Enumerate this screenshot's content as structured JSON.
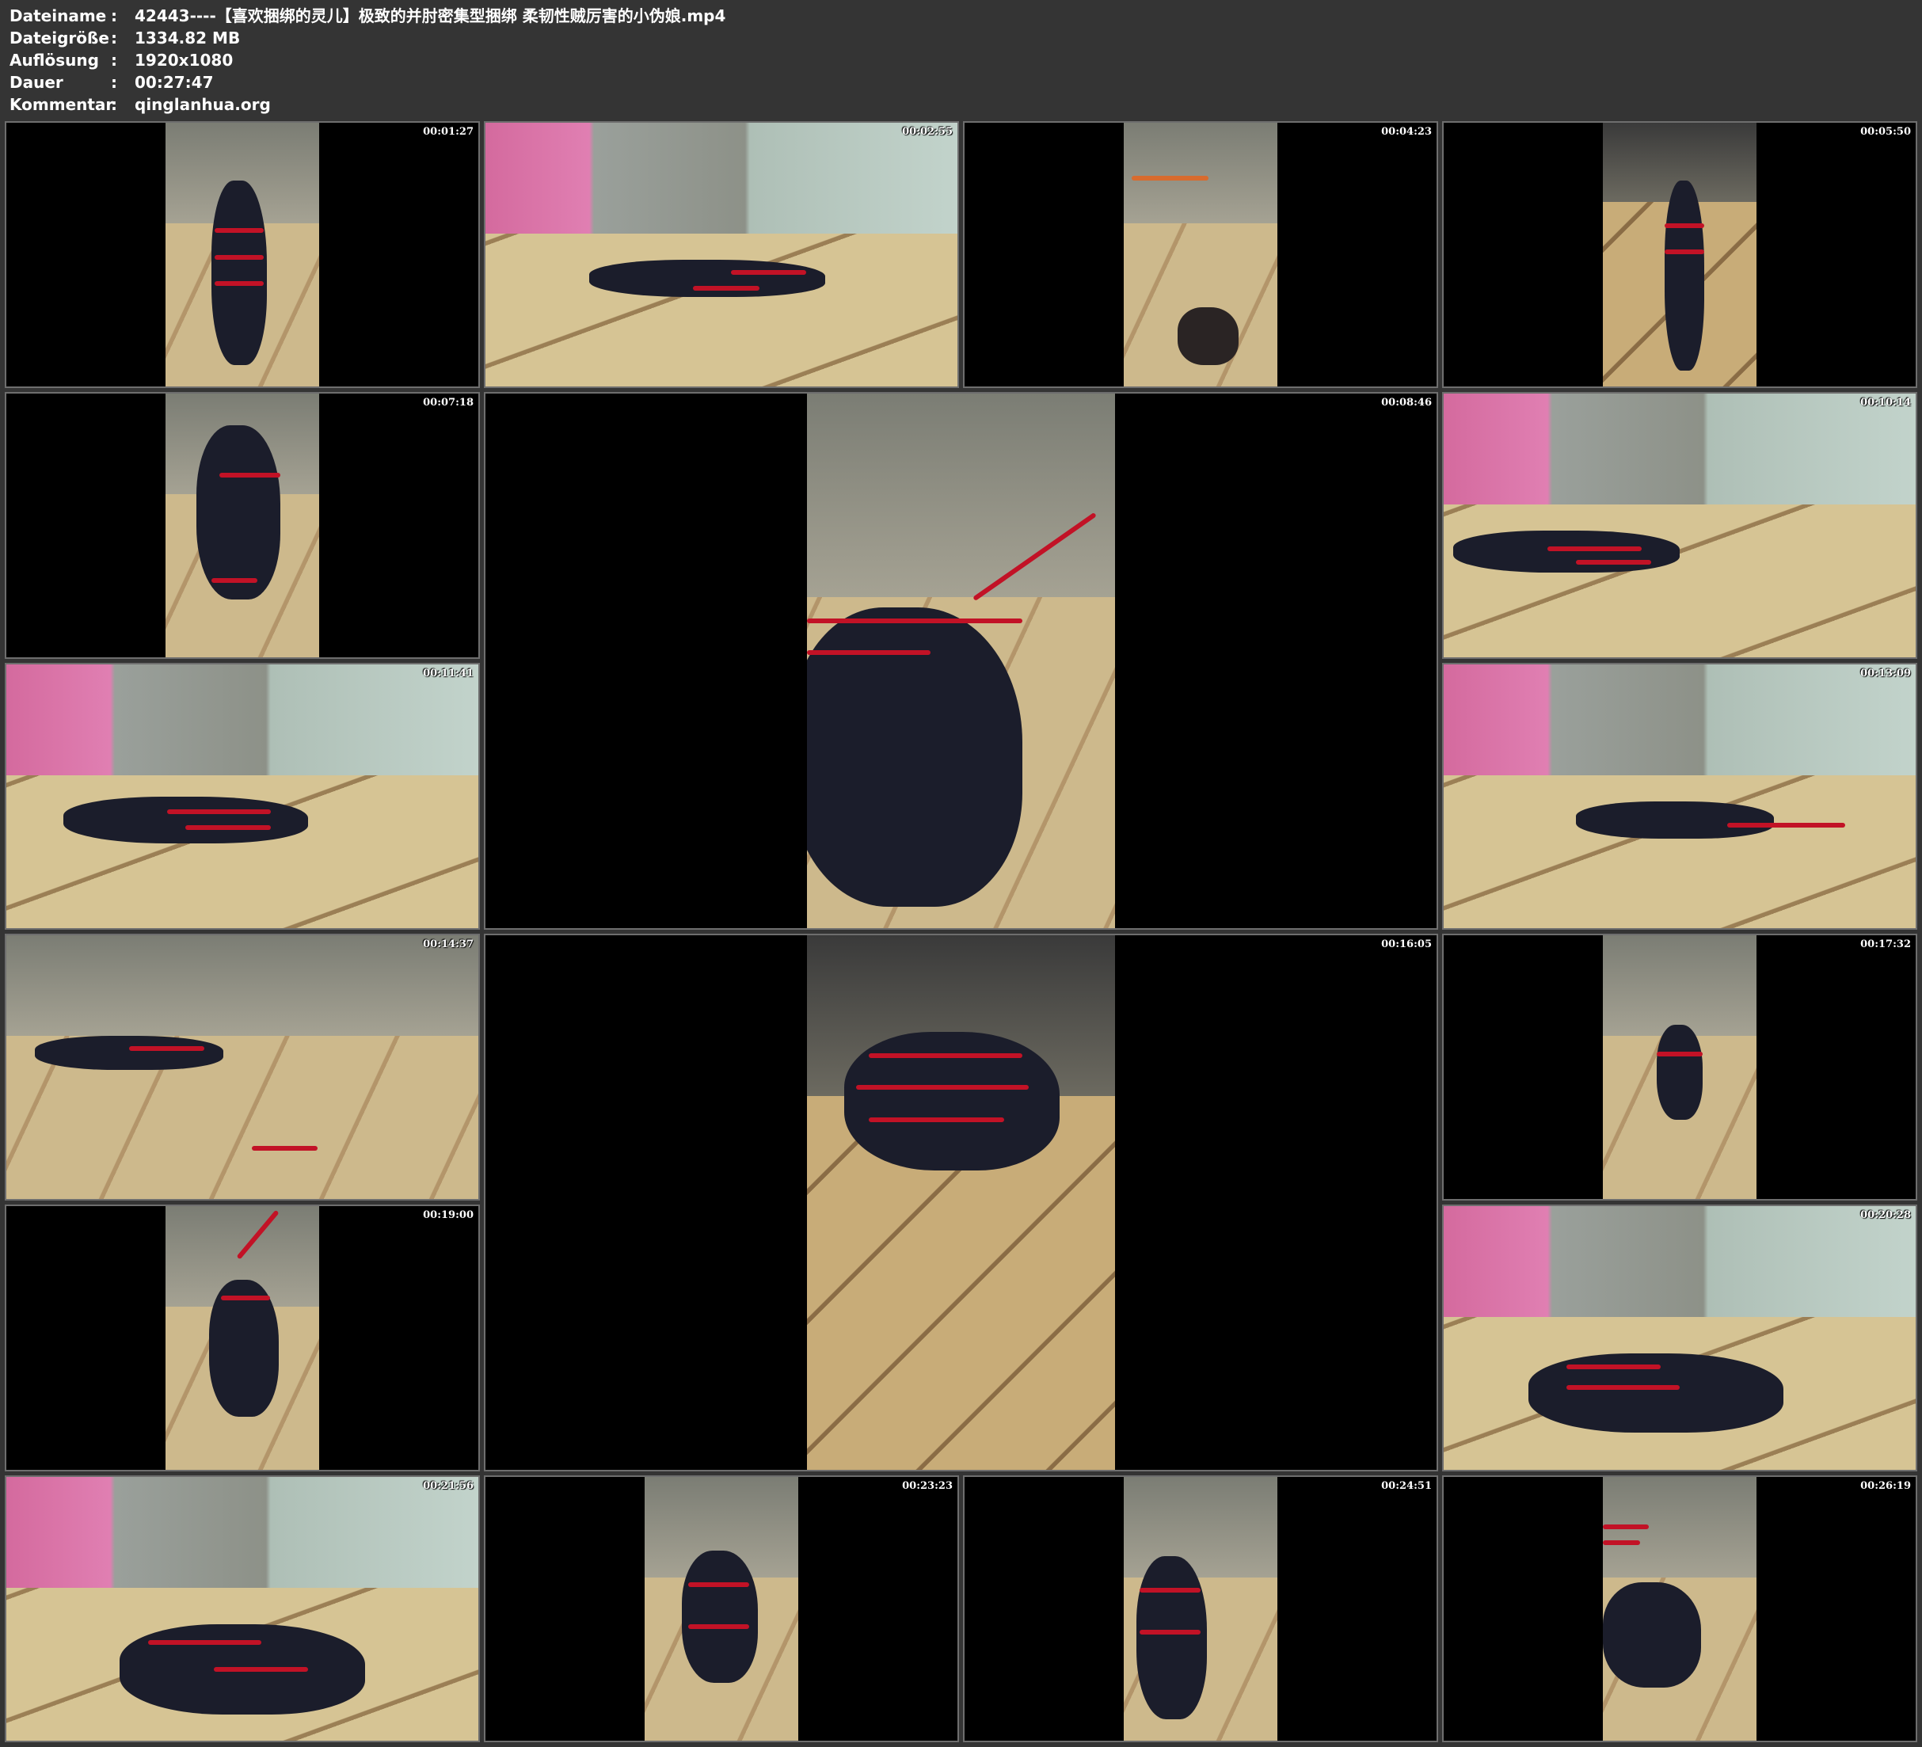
{
  "info": {
    "rows": [
      {
        "key": "Dateiname",
        "sep": ":",
        "value": "42443----【喜欢捆绑的灵儿】极致的并肘密集型捆绑 柔韧性贼厉害的小伪娘.mp4"
      },
      {
        "key": "Dateigröße",
        "sep": ":",
        "value": "1334.82 MB"
      },
      {
        "key": "Auflösung",
        "sep": ":",
        "value": "1920x1080"
      },
      {
        "key": "Dauer",
        "sep": ":",
        "value": "00:27:47"
      },
      {
        "key": "Kommentar",
        "sep": ":",
        "value": "qinglanhua.org"
      }
    ]
  },
  "thumbnails": [
    {
      "timestamp": "00:01:27"
    },
    {
      "timestamp": "00:02:55"
    },
    {
      "timestamp": "00:04:23"
    },
    {
      "timestamp": "00:05:50"
    },
    {
      "timestamp": "00:07:18"
    },
    {
      "timestamp": "00:08:46"
    },
    {
      "timestamp": "00:10:14"
    },
    {
      "timestamp": "00:11:41"
    },
    {
      "timestamp": "00:13:09"
    },
    {
      "timestamp": "00:14:37"
    },
    {
      "timestamp": "00:16:05"
    },
    {
      "timestamp": "00:17:32"
    },
    {
      "timestamp": "00:19:00"
    },
    {
      "timestamp": "00:20:28"
    },
    {
      "timestamp": "00:21:56"
    },
    {
      "timestamp": "00:23:23"
    },
    {
      "timestamp": "00:24:51"
    },
    {
      "timestamp": "00:26:19"
    }
  ]
}
